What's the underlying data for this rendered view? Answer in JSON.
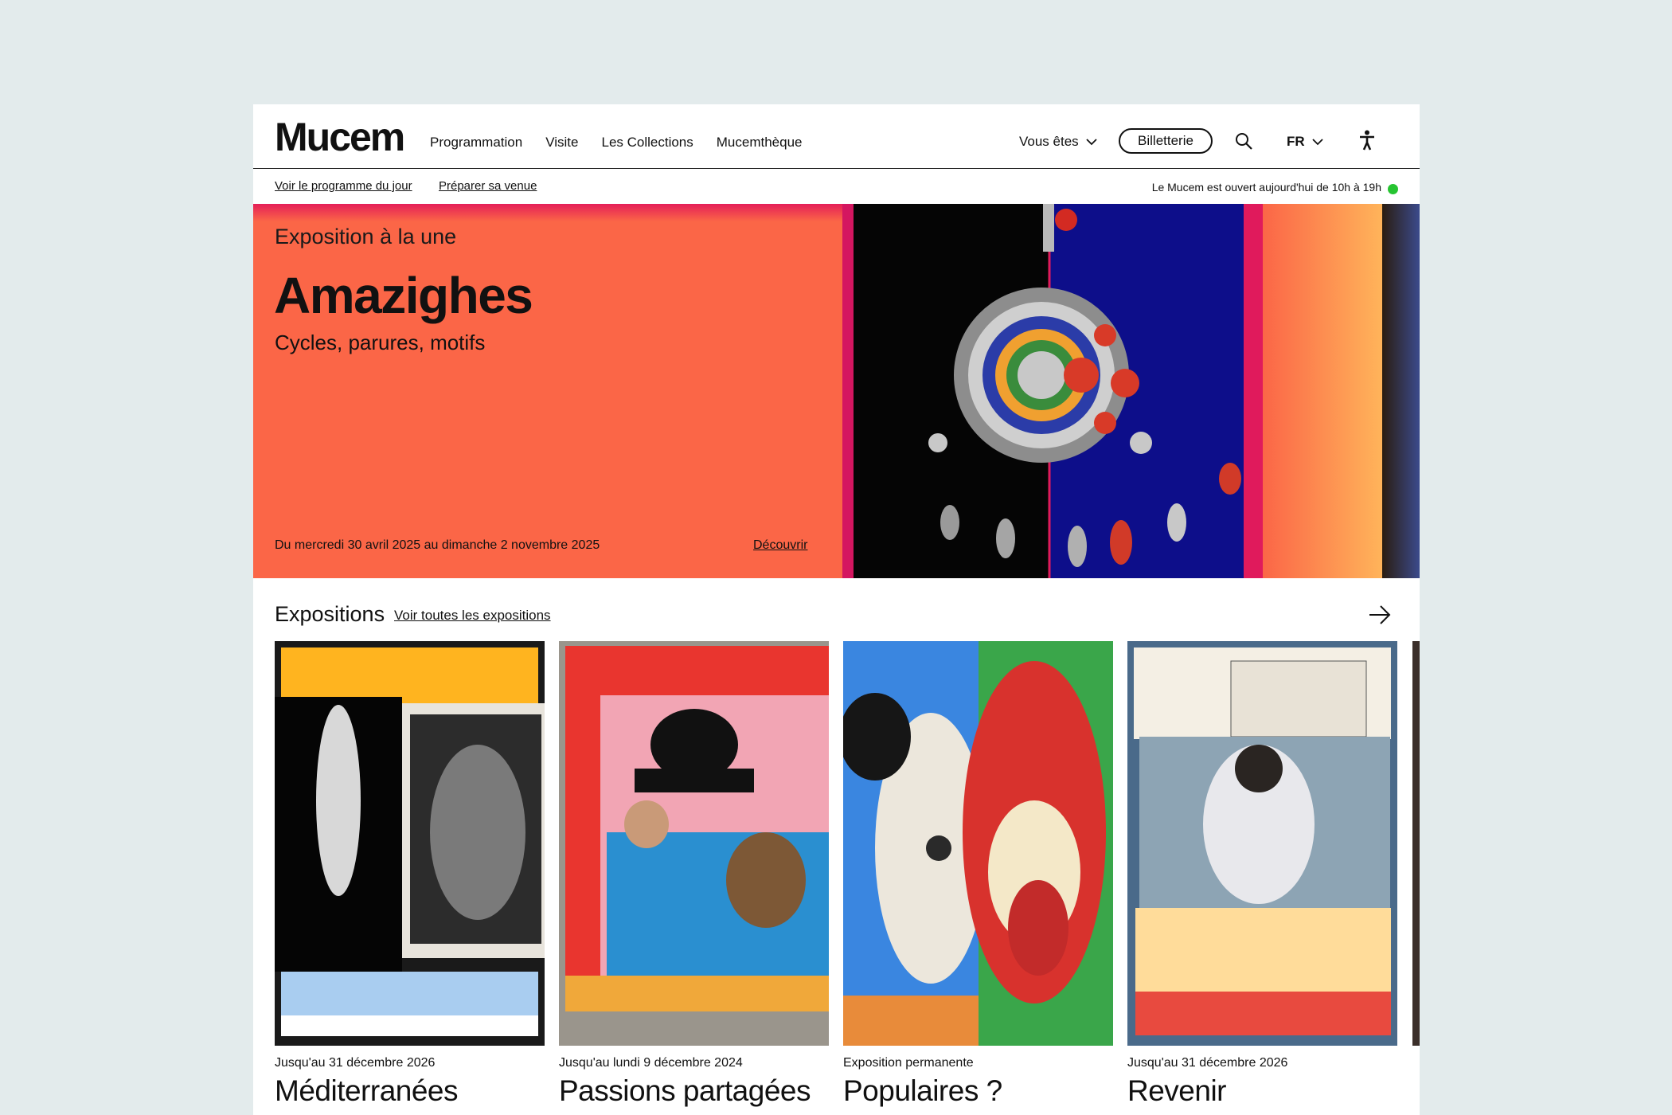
{
  "header": {
    "logo": "Mucem",
    "nav": [
      "Programmation",
      "Visite",
      "Les Collections",
      "Mucemthèque"
    ],
    "vous_etes": "Vous êtes",
    "billetterie": "Billetterie",
    "language": "FR"
  },
  "subbar": {
    "link_programme": "Voir le programme du jour",
    "link_venue": "Préparer sa venue",
    "status": "Le Mucem est ouvert aujourd'hui de 10h à 19h",
    "status_color": "#26c431"
  },
  "hero": {
    "label": "Exposition à la une",
    "title": "Amazighes",
    "subtitle": "Cycles, parures, motifs",
    "dates": "Du mercredi 30 avril 2025 au dimanche 2 novembre 2025",
    "cta": "Découvrir",
    "background": "#fb6647"
  },
  "expositions": {
    "title": "Expositions",
    "see_all": "Voir toutes les expositions",
    "cards": [
      {
        "date": "Jusqu'au 31 décembre 2026",
        "title": "Méditerranées"
      },
      {
        "date": "Jusqu'au lundi 9 décembre 2024",
        "title": "Passions partagées"
      },
      {
        "date": "Exposition permanente",
        "title": "Populaires ?"
      },
      {
        "date": "Jusqu'au 31 décembre 2026",
        "title": "Revenir"
      }
    ]
  }
}
